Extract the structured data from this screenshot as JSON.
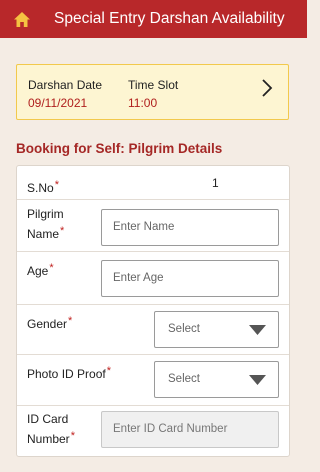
{
  "header": {
    "title": "Special Entry Darshan Availability",
    "icon": "home-icon"
  },
  "summary": {
    "date_label": "Darshan Date",
    "date_value": "09/11/2021",
    "slot_label": "Time Slot",
    "slot_value": "11:00"
  },
  "section_title": "Booking for Self: Pilgrim Details",
  "form": {
    "sno_label": "S.No",
    "sno_value": "1",
    "name_label_1": "Pilgrim",
    "name_label_2": "Name",
    "name_placeholder": "Enter Name",
    "age_label": "Age",
    "age_placeholder": "Enter Age",
    "gender_label": "Gender",
    "gender_value": "Select",
    "photo_label": "Photo ID Proof",
    "photo_value": "Select",
    "idcard_label_1": "ID Card",
    "idcard_label_2": "Number",
    "idcard_placeholder": "Enter ID Card Number",
    "required_mark": "*"
  },
  "colors": {
    "header_bg": "#b8282a",
    "accent": "#a52826",
    "card_bg": "#fdf5d2",
    "card_border": "#f2c94c"
  }
}
